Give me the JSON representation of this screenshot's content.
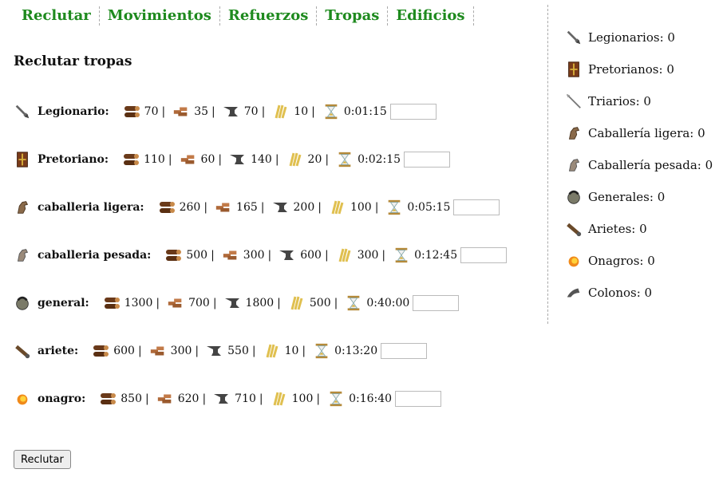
{
  "tabs": [
    "Reclutar",
    "Movimientos",
    "Refuerzos",
    "Tropas",
    "Edificios"
  ],
  "heading": "Reclutar tropas",
  "units": [
    {
      "icon": "sword-icon",
      "name": "Legionario:",
      "wood": "70",
      "clay": "35",
      "iron": "70",
      "food": "10",
      "time": "0:01:15"
    },
    {
      "icon": "shield-icon",
      "name": "Pretoriano:",
      "wood": "110",
      "clay": "60",
      "iron": "140",
      "food": "20",
      "time": "0:02:15"
    },
    {
      "icon": "light-cavalry-icon",
      "name": "caballeria ligera:",
      "wood": "260",
      "clay": "165",
      "iron": "200",
      "food": "100",
      "time": "0:05:15"
    },
    {
      "icon": "heavy-cavalry-icon",
      "name": "caballeria pesada:",
      "wood": "500",
      "clay": "300",
      "iron": "600",
      "food": "300",
      "time": "0:12:45"
    },
    {
      "icon": "general-helmet-icon",
      "name": "general:",
      "wood": "1300",
      "clay": "700",
      "iron": "1800",
      "food": "500",
      "time": "0:40:00"
    },
    {
      "icon": "ram-icon",
      "name": "ariete:",
      "wood": "600",
      "clay": "300",
      "iron": "550",
      "food": "10",
      "time": "0:13:20"
    },
    {
      "icon": "catapult-fireball-icon",
      "name": "onagro:",
      "wood": "850",
      "clay": "620",
      "iron": "710",
      "food": "100",
      "time": "0:16:40"
    }
  ],
  "separator": "|",
  "recruit_button": "Reclutar",
  "troops": [
    {
      "icon": "sword-icon",
      "label": "Legionarios: 0"
    },
    {
      "icon": "shield-icon",
      "label": "Pretorianos: 0"
    },
    {
      "icon": "spear-icon",
      "label": "Triarios: 0"
    },
    {
      "icon": "light-cavalry-icon",
      "label": "Caballería ligera: 0"
    },
    {
      "icon": "heavy-cavalry-icon",
      "label": "Caballería pesada: 0"
    },
    {
      "icon": "general-helmet-icon",
      "label": "Generales: 0"
    },
    {
      "icon": "ram-icon",
      "label": "Arietes: 0"
    },
    {
      "icon": "catapult-fireball-icon",
      "label": "Onagros: 0"
    },
    {
      "icon": "settler-icon",
      "label": "Colonos: 0"
    }
  ],
  "colors": {
    "tab": "#1e8a1e"
  }
}
